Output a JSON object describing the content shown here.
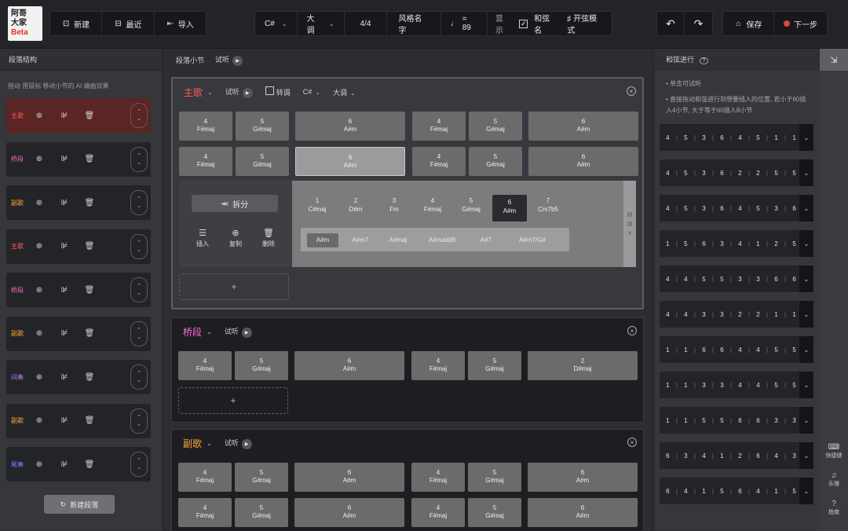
{
  "logo": {
    "line1": "阿哥",
    "line2": "大家",
    "line3": "Beta"
  },
  "toolbar": {
    "file_buttons": [
      {
        "icon": "new-icon",
        "glyph": "⊡",
        "label": "新建"
      },
      {
        "icon": "recent-icon",
        "glyph": "⊟",
        "label": "最近"
      },
      {
        "icon": "import-icon",
        "glyph": "⇤",
        "label": "导入"
      }
    ],
    "key": "C#",
    "mode": "大调",
    "time_sig": "4/4",
    "style_name": "风格名字",
    "tempo_note": "♩",
    "tempo_value": "= 89",
    "display_label": "显示",
    "chord_names_label": "和弦名",
    "pro_mode_label": "♯ 开弦模式",
    "undo_glyph": "↶",
    "redo_glyph": "↷",
    "save_label": "保存",
    "next_label": "下一步"
  },
  "left_panel": {
    "title": "段落结构",
    "hint": "拖动 用鼠标 移动小节的 AI 编曲效果",
    "sections": [
      {
        "tag": "主歌",
        "color": "#ff5a5a",
        "active": true
      },
      {
        "tag": "桥段",
        "color": "#ff6ad2",
        "active": false
      },
      {
        "tag": "副歌",
        "color": "#ffa43a",
        "active": false
      },
      {
        "tag": "主歌",
        "color": "#ff5a5a",
        "active": false
      },
      {
        "tag": "桥段",
        "color": "#ff6ad2",
        "active": false
      },
      {
        "tag": "副歌",
        "color": "#ffa43a",
        "active": false
      },
      {
        "tag": "间奏",
        "color": "#b67cff",
        "active": false
      },
      {
        "tag": "副歌",
        "color": "#ffa43a",
        "active": false
      },
      {
        "tag": "尾奏",
        "color": "#6a8cff",
        "active": false
      }
    ],
    "new_section_label": "新建段落"
  },
  "center": {
    "header": {
      "title": "段落小节",
      "preview": "试听"
    },
    "blocks": [
      {
        "title": "主歌",
        "color": "#ff5a5a",
        "preview": "试听",
        "transpose": "转调",
        "key": "C#",
        "mode": "大调",
        "rows": [
          [
            {
              "deg": "4",
              "name": "F#maj"
            },
            {
              "deg": "5",
              "name": "G#maj"
            },
            {
              "deg": "6",
              "name": "A#m"
            },
            {
              "deg": "4",
              "name": "F#maj"
            },
            {
              "deg": "5",
              "name": "G#maj"
            },
            {
              "deg": "6",
              "name": "A#m"
            }
          ],
          [
            {
              "deg": "4",
              "name": "F#maj"
            },
            {
              "deg": "5",
              "name": "G#maj"
            },
            {
              "deg": "6",
              "name": "A#m"
            },
            {
              "deg": "4",
              "name": "F#maj"
            },
            {
              "deg": "5",
              "name": "G#maj"
            },
            {
              "deg": "6",
              "name": "A#m"
            }
          ]
        ]
      },
      {
        "title": "桥段",
        "color": "#ff6ad2",
        "preview": "试听",
        "rows": [
          [
            {
              "deg": "4",
              "name": "F#maj"
            },
            {
              "deg": "5",
              "name": "G#maj"
            },
            {
              "deg": "6",
              "name": "A#m"
            },
            {
              "deg": "4",
              "name": "F#maj"
            },
            {
              "deg": "5",
              "name": "G#maj"
            },
            {
              "deg": "2",
              "name": "D#maj"
            }
          ]
        ]
      },
      {
        "title": "副歌",
        "color": "#ffa43a",
        "preview": "试听",
        "rows": [
          [
            {
              "deg": "4",
              "name": "F#maj"
            },
            {
              "deg": "5",
              "name": "G#maj"
            },
            {
              "deg": "6",
              "name": "A#m"
            },
            {
              "deg": "4",
              "name": "F#maj"
            },
            {
              "deg": "5",
              "name": "G#maj"
            },
            {
              "deg": "6",
              "name": "A#m"
            }
          ],
          [
            {
              "deg": "4",
              "name": "F#maj"
            },
            {
              "deg": "5",
              "name": "G#maj"
            },
            {
              "deg": "6",
              "name": "A#m"
            },
            {
              "deg": "4",
              "name": "F#maj"
            },
            {
              "deg": "5",
              "name": "G#maj"
            },
            {
              "deg": "6",
              "name": "A#m"
            }
          ]
        ]
      }
    ],
    "editor": {
      "split_label": "拆分",
      "actions": [
        {
          "icon": "insert-icon",
          "glyph": "☰",
          "label": "插入"
        },
        {
          "icon": "copy-icon",
          "glyph": "⊕",
          "label": "复制"
        },
        {
          "icon": "delete-icon",
          "glyph": "🗑",
          "label": "删除"
        }
      ],
      "degrees": [
        {
          "deg": "1",
          "name": "C#maj"
        },
        {
          "deg": "2",
          "name": "D#m"
        },
        {
          "deg": "3",
          "name": "Fm"
        },
        {
          "deg": "4",
          "name": "F#maj"
        },
        {
          "deg": "5",
          "name": "G#maj"
        },
        {
          "deg": "6",
          "name": "A#m",
          "on": true
        },
        {
          "deg": "7",
          "name": "Cm7b5"
        }
      ],
      "variants": [
        "A#m",
        "A#m7",
        "A#maj",
        "A#madd9",
        "A#7",
        "A#m7/G#"
      ]
    },
    "add_label": "+"
  },
  "right_panel": {
    "title": "和弦进行",
    "bullets": [
      "单击可试听",
      "直接拖动和弦进行到想要插入的位置, 若小于60插入4小节, 大于等于60插入8小节"
    ],
    "progressions": [
      [
        "4",
        "5",
        "3",
        "6",
        "4",
        "5",
        "1",
        "1"
      ],
      [
        "4",
        "5",
        "3",
        "6",
        "2",
        "2",
        "5",
        "5"
      ],
      [
        "4",
        "5",
        "3",
        "6",
        "4",
        "5",
        "3",
        "6"
      ],
      [
        "1",
        "5",
        "6",
        "3",
        "4",
        "1",
        "2",
        "5"
      ],
      [
        "4",
        "4",
        "5",
        "5",
        "3",
        "3",
        "6",
        "6"
      ],
      [
        "4",
        "4",
        "3",
        "3",
        "2",
        "2",
        "1",
        "1"
      ],
      [
        "1",
        "1",
        "6",
        "6",
        "4",
        "4",
        "5",
        "5"
      ],
      [
        "1",
        "1",
        "3",
        "3",
        "4",
        "4",
        "5",
        "5"
      ],
      [
        "1",
        "1",
        "5",
        "5",
        "6",
        "6",
        "3",
        "3"
      ],
      [
        "6",
        "3",
        "4",
        "1",
        "2",
        "6",
        "4",
        "3"
      ],
      [
        "6",
        "4",
        "1",
        "5",
        "6",
        "4",
        "1",
        "5"
      ]
    ]
  },
  "far_right": {
    "top_glyph": "⇲",
    "buttons": [
      {
        "icon": "shortcut-icon",
        "glyph": "⌨",
        "label": "快捷键"
      },
      {
        "icon": "theory-icon",
        "glyph": "♫",
        "label": "乐理"
      },
      {
        "icon": "guide-icon",
        "glyph": "?",
        "label": "指南"
      }
    ]
  }
}
